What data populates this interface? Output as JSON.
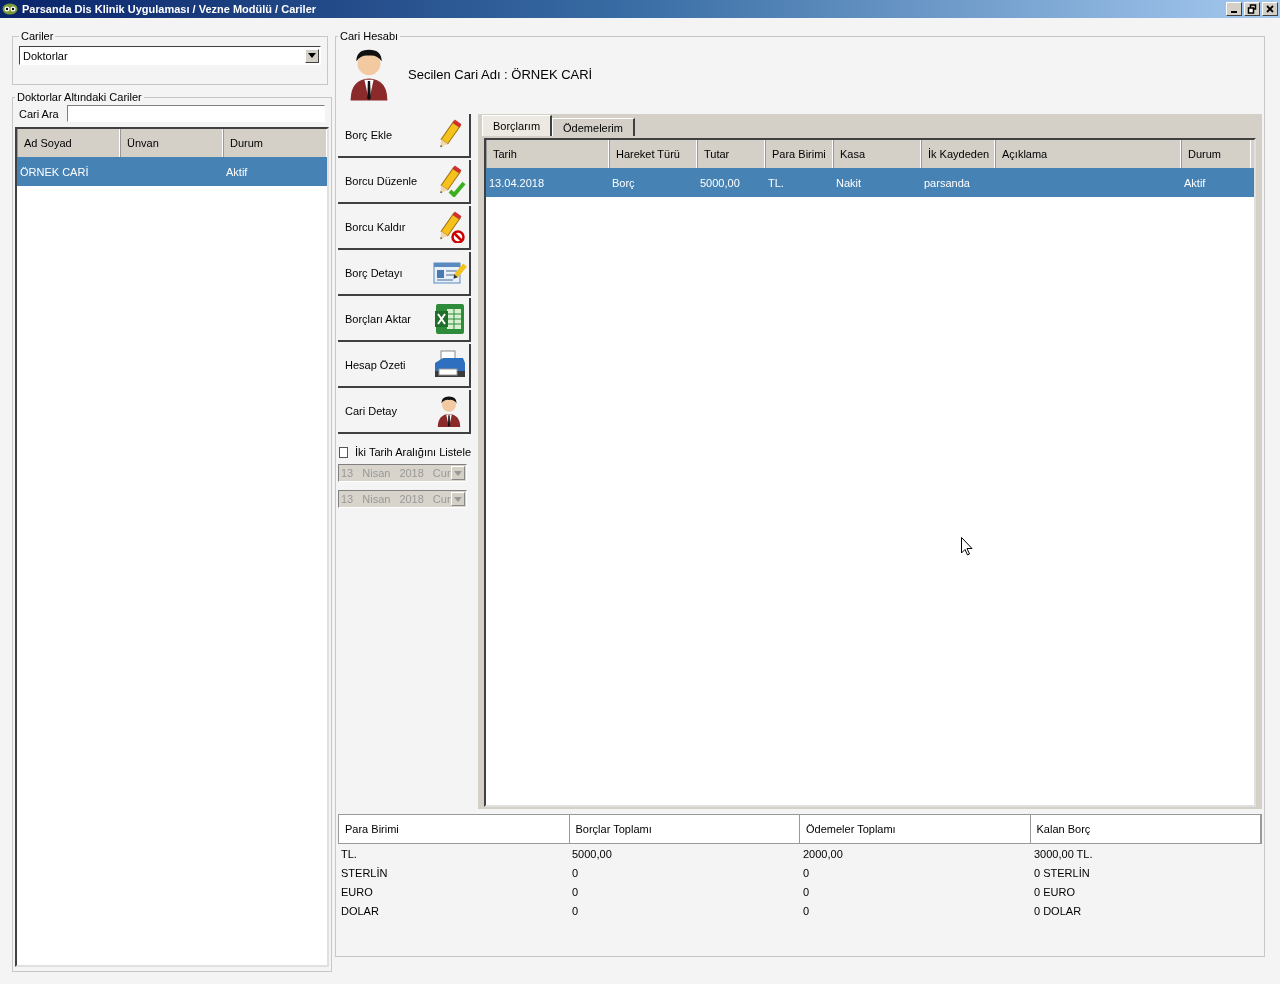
{
  "window": {
    "title": "Parsanda Dis Klinik Uygulaması / Vezne Modülü / Cariler"
  },
  "cariler": {
    "legend": "Cariler",
    "value": "Doktorlar"
  },
  "cari_list": {
    "legend": "Doktorlar Altındaki Cariler",
    "search_label": "Cari Ara",
    "columns": [
      "Ad Soyad",
      "Ünvan",
      "Durum"
    ],
    "rows": [
      {
        "cells": [
          "ÖRNEK CARİ",
          "",
          "Aktif"
        ],
        "selected": true
      }
    ]
  },
  "account": {
    "legend": "Cari Hesabı",
    "selected_name": "Secilen Cari Adı : ÖRNEK CARİ"
  },
  "actions": [
    {
      "label": "Borç Ekle",
      "kind": "pencil"
    },
    {
      "label": "Borcu Düzenle",
      "kind": "edit"
    },
    {
      "label": "Borcu Kaldır",
      "kind": "remove"
    },
    {
      "label": "Borç Detayı",
      "kind": "card"
    },
    {
      "label": "Borçları Aktar",
      "kind": "sheet"
    },
    {
      "label": "Hesap Özeti",
      "kind": "printer"
    },
    {
      "label": "Cari Detay",
      "kind": "person"
    }
  ],
  "date_range": {
    "label": "İki Tarih Aralığını Listele",
    "checked": false,
    "dates": [
      {
        "day": "13",
        "month": "Nisan",
        "year": "2018",
        "weekday": "Cur",
        "disabled": true
      },
      {
        "day": "13",
        "month": "Nisan",
        "year": "2018",
        "weekday": "Cur",
        "disabled": true
      }
    ]
  },
  "tabs": [
    {
      "label": "Borçlarım",
      "selected": true
    },
    {
      "label": "Ödemelerim",
      "selected": false
    }
  ],
  "table": {
    "columns": [
      "Tarih",
      "Hareket Türü",
      "Tutar",
      "Para Birimi",
      "Kasa",
      "İk Kaydeden",
      "Açıklama",
      "Durum"
    ],
    "rows": [
      {
        "cells": [
          "13.04.2018",
          "Borç",
          "5000,00",
          "TL.",
          "Nakit",
          "parsanda",
          "",
          "Aktif"
        ],
        "selected": true
      }
    ]
  },
  "summary": {
    "columns": [
      "Para Birimi",
      "Borçlar Toplamı",
      "Ödemeler Toplamı",
      "Kalan Borç"
    ],
    "rows": [
      [
        "TL.",
        "5000,00",
        "2000,00",
        "3000,00 TL."
      ],
      [
        "STERLİN",
        "0",
        "0",
        "0 STERLİN"
      ],
      [
        "EURO",
        "0",
        "0",
        "0 EURO"
      ],
      [
        "DOLAR",
        "0",
        "0",
        "0 DOLAR"
      ]
    ]
  }
}
